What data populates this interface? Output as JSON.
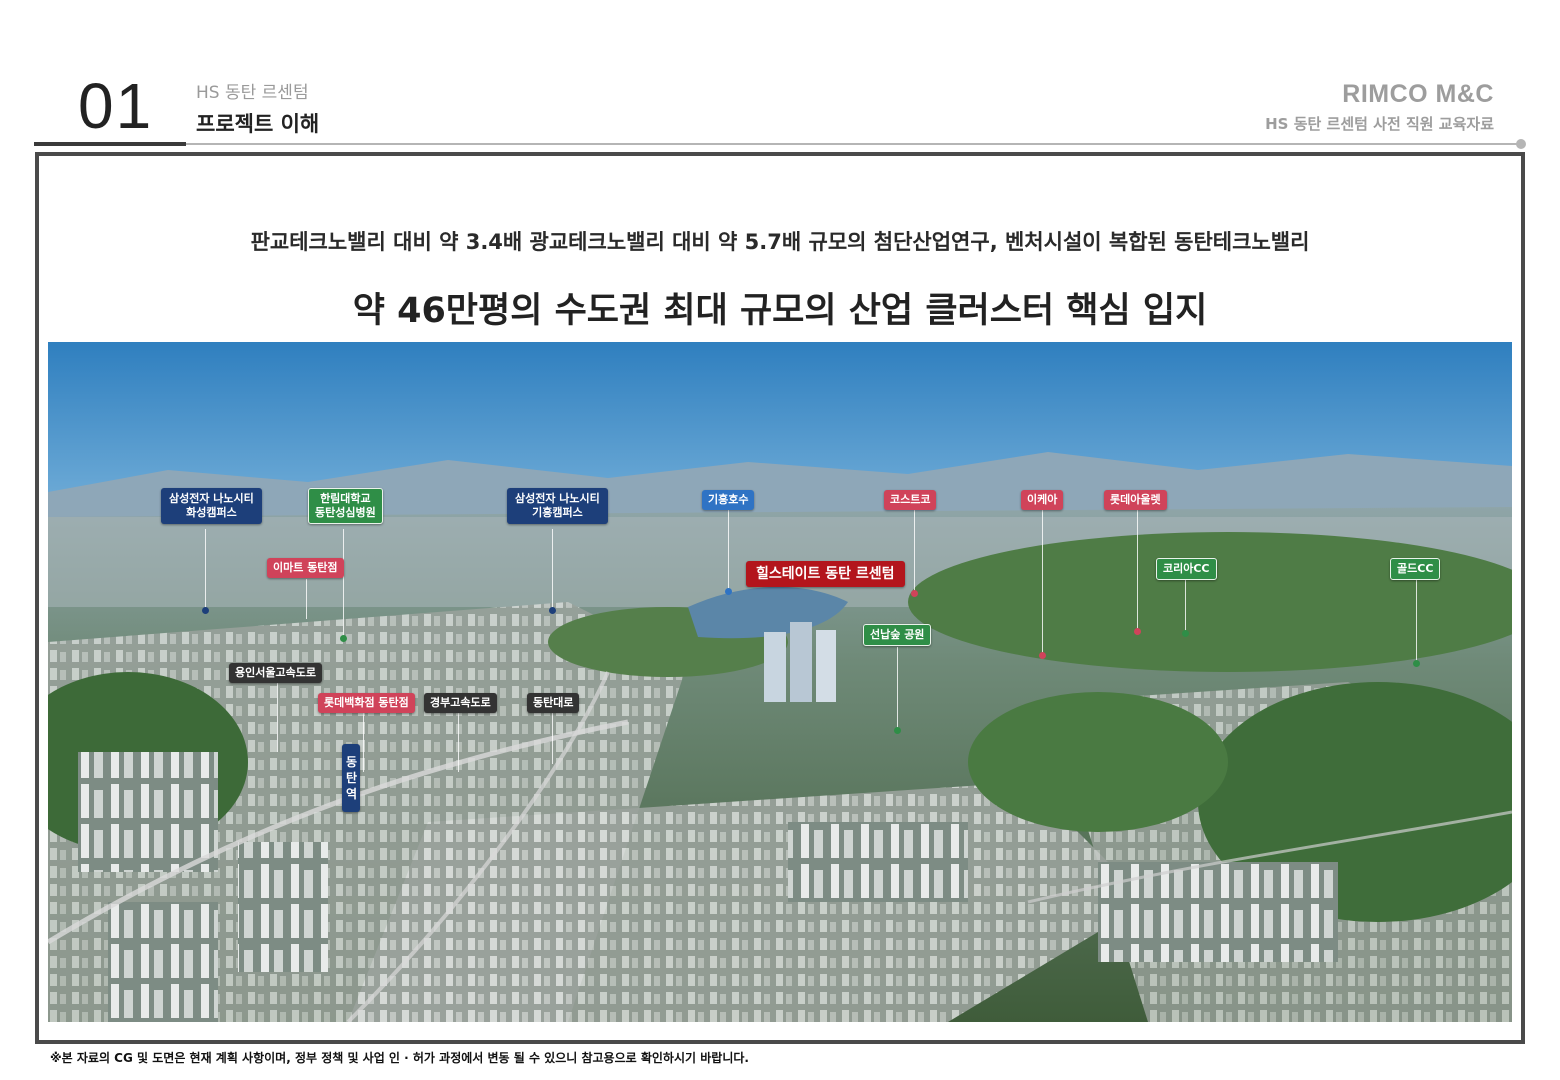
{
  "header": {
    "number": "01",
    "subtitle": "HS 동탄 르센텀",
    "title": "프로젝트 이해",
    "brand": "RIMCO M&C",
    "brand_sub": "HS 동탄 르센텀 사전 직원 교육자료"
  },
  "content": {
    "line1": "판교테크노밸리 대비 약 3.4배 광교테크노밸리 대비 약 5.7배 규모의 첨단산업연구, 벤처시설이 복합된 동탄테크노밸리",
    "line2": "약 46만평의 수도권 최대 규모의 산업 클러스터 핵심 입지"
  },
  "map": {
    "samsung_hwaseong": [
      "삼성전자 나노시티",
      "화성캠퍼스"
    ],
    "hallym": [
      "한림대학교",
      "동탄성심병원"
    ],
    "samsung_giheung": [
      "삼성전자 나노시티",
      "기흥캠퍼스"
    ],
    "giheung_lake": "기흥호수",
    "costco": "코스트코",
    "ikea": "이케아",
    "lotte_outlet": "롯데아울렛",
    "emart": "이마트 동탄점",
    "project": "힐스테이트 동탄 르센텀",
    "korea_cc": "코리아CC",
    "gold_cc": "골드CC",
    "seonnamsup": "선납숲 공원",
    "yongin_highway": "용인서울고속도로",
    "lotte_dept": "롯데백화점 동탄점",
    "gyeongbu": "경부고속도로",
    "dongtan_daero": "동탄대로",
    "dongtan_station": "동탄역"
  },
  "footnote": "※본 자료의 CG 및 도면은 현재 계획 사항이며, 정부 정책 및 사업 인 · 허가 과정에서 변동 될 수 있으니 참고용으로 확인하시기 바랍니다."
}
